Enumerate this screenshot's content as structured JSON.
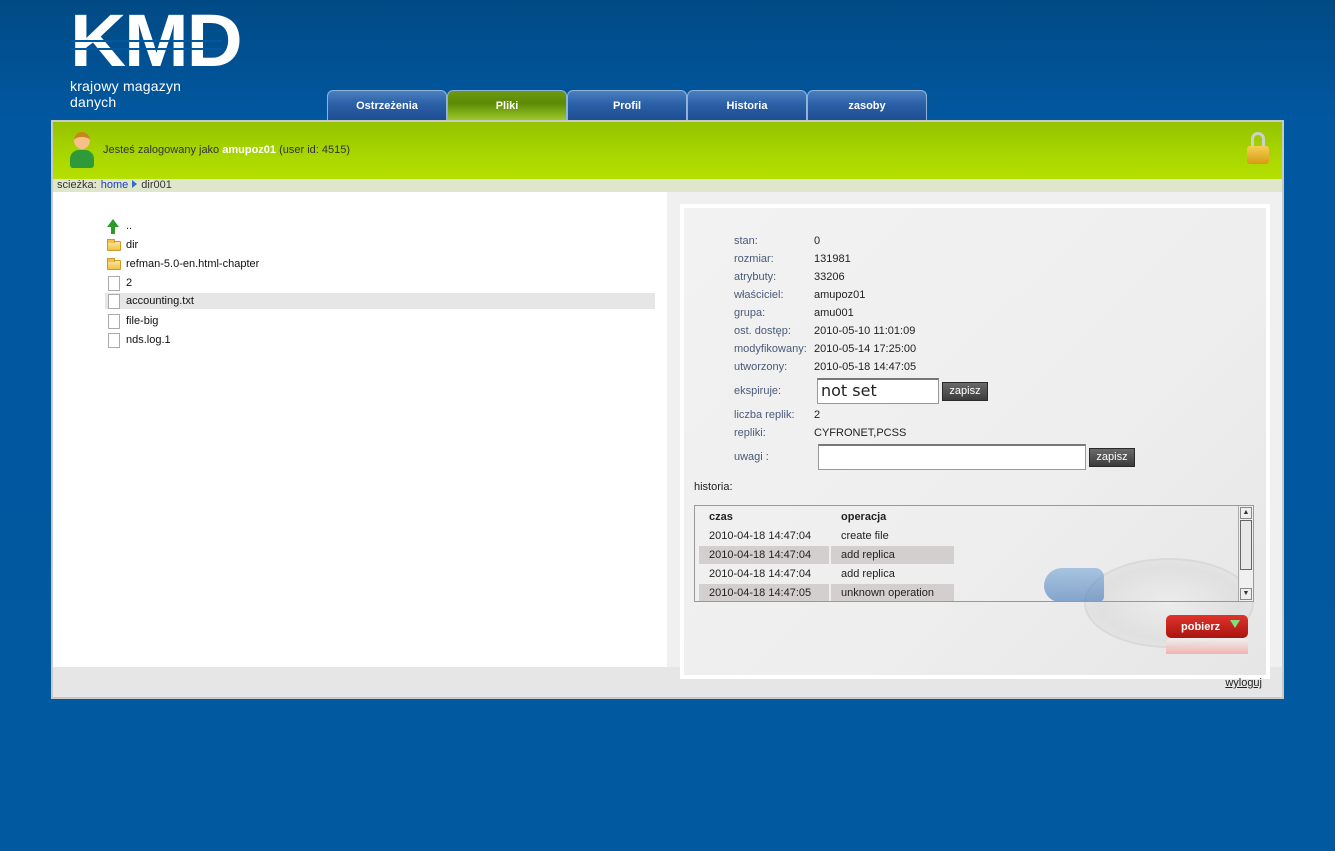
{
  "logo": {
    "title": "KMD",
    "subtitle": "krajowy magazyn danych"
  },
  "tabs": [
    {
      "label": "Ostrzeżenia",
      "active": false
    },
    {
      "label": "Pliki",
      "active": true
    },
    {
      "label": "Profil",
      "active": false
    },
    {
      "label": "Historia",
      "active": false
    },
    {
      "label": "zasoby",
      "active": false
    }
  ],
  "header": {
    "login_prefix": "Jesteś zalogowany jako",
    "username": "amupoz01",
    "user_id_text": "(user id: 4515)"
  },
  "path": {
    "label": "scieżka:",
    "home": "home",
    "current": "dir001"
  },
  "files": [
    {
      "name": "..",
      "type": "up"
    },
    {
      "name": "dir",
      "type": "folder"
    },
    {
      "name": "refman-5.0-en.html-chapter",
      "type": "folder"
    },
    {
      "name": "2",
      "type": "file"
    },
    {
      "name": "accounting.txt",
      "type": "file",
      "selected": true
    },
    {
      "name": "file-big",
      "type": "file"
    },
    {
      "name": "nds.log.1",
      "type": "file"
    }
  ],
  "details": {
    "stan_label": "stan:",
    "stan": "0",
    "rozmiar_label": "rozmiar:",
    "rozmiar": "131981",
    "atrybuty_label": "atrybuty:",
    "atrybuty": "33206",
    "wlasciciel_label": "właściciel:",
    "wlasciciel": "amupoz01",
    "grupa_label": "grupa:",
    "grupa": "amu001",
    "ost_dostep_label": "ost. dostęp:",
    "ost_dostep": "2010-05-10 11:01:09",
    "modyfikowany_label": "modyfikowany:",
    "modyfikowany": "2010-05-14 17:25:00",
    "utworzony_label": "utworzony:",
    "utworzony": "2010-05-18 14:47:05",
    "ekspiruje_label": "ekspiruje:",
    "ekspiruje": "not set",
    "liczba_replik_label": "liczba replik:",
    "liczba_replik": "2",
    "repliki_label": "repliki:",
    "repliki": "CYFRONET,PCSS",
    "uwagi_label": "uwagi :",
    "uwagi": "",
    "save_label": "zapisz"
  },
  "history": {
    "label": "historia:",
    "columns": [
      "czas",
      "operacja"
    ],
    "rows": [
      [
        "2010-04-18 14:47:04",
        "create file"
      ],
      [
        "2010-04-18 14:47:04",
        "add replica"
      ],
      [
        "2010-04-18 14:47:04",
        "add replica"
      ],
      [
        "2010-04-18 14:47:05",
        "unknown operation"
      ]
    ]
  },
  "download_label": "pobierz",
  "logout_label": "wyloguj",
  "colors": {
    "background": "#01599f",
    "tab": "#2b5fa6",
    "tab_active": "#5c8a05",
    "green_bar": "#a6d400",
    "button_red": "#c41f19"
  }
}
